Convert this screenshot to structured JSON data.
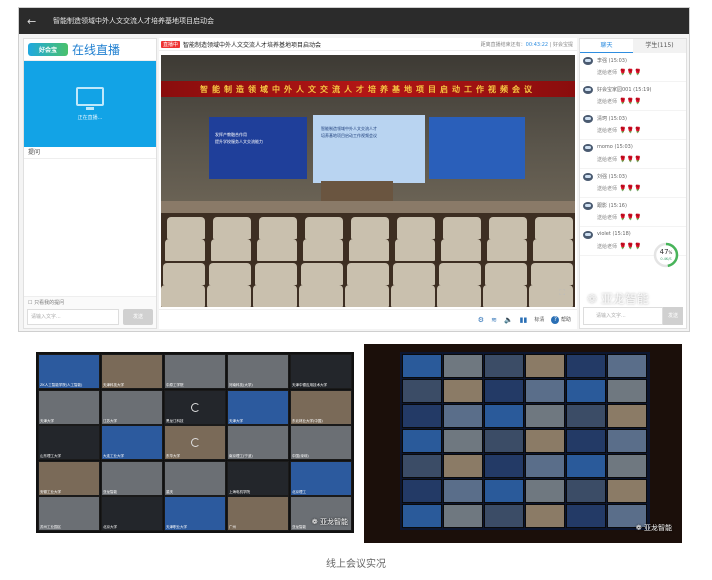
{
  "app": {
    "window_title": "智能制造领域中外人文交流人才培养基地项目启动会",
    "brand": {
      "logo_text": "好会宝",
      "title": "在线直播"
    },
    "camera": {
      "status": "正在直播..."
    },
    "qa": {
      "header": "提问",
      "anonymous_label": "只看我的提问",
      "input_placeholder": "请输入文字...",
      "send_label": "发送"
    },
    "video": {
      "live_badge": "直播中",
      "title": "智能制造领域中外人文交流人才培养基地项目启动会",
      "meta_prefix": "距离直播结束还有：",
      "countdown": "00:43:22",
      "meta_suffix": "| 好会宝提",
      "banner": "智能制造领域中外人文交流人才培养基地项目启动工作视频会议",
      "left_screen_lines": [
        "发挥产教融合作用",
        "提升学校服务人文交流能力"
      ],
      "mid_screen_lines": [
        "智能制造领域中外人文交流人才",
        "培养基地项目启动工作视频会议"
      ]
    },
    "controls": {
      "quality_label": "标清",
      "help_label": "帮助"
    },
    "chat": {
      "tabs": [
        "聊天",
        "学生(115)"
      ],
      "messages": [
        {
          "name": "李强",
          "time": "(15:03)",
          "text": "送给老师"
        },
        {
          "name": "好会宝家园001",
          "time": "(15:19)",
          "text": "送给老师"
        },
        {
          "name": "清珂",
          "time": "(15:03)",
          "text": "送给老师"
        },
        {
          "name": "momo",
          "time": "(15:03)",
          "text": "送给老师"
        },
        {
          "name": "刘强",
          "time": "(15:03)",
          "text": "送给老师"
        },
        {
          "name": "跟影",
          "time": "(15:16)",
          "text": "送给老师"
        },
        {
          "name": "violet",
          "time": "(15:18)",
          "text": "送给老师"
        }
      ],
      "flowers": "🌹🌹🌹",
      "gauge_value": "47",
      "gauge_unit": "%",
      "gauge_sub": "0.4K/S",
      "gauge_fraction": 0.47,
      "input_placeholder": "请输入文字...",
      "send_label": "发送"
    },
    "watermark": "亚龙智能"
  },
  "grid_photo": {
    "tiles": [
      "ZK人工智能学院(人工智能)",
      "天津科技大学",
      "中原工学院",
      "河南科技(大学)",
      "天津中德应用技术大学",
      "天津大学",
      "江苏大学",
      "黑龙江科技",
      "天津大学",
      "东北林业大学(中国)",
      "山东理工大学",
      "大连工业大学",
      "东华大学",
      "南京理工(宁波)",
      "中国(深圳)",
      "安徽工业大学",
      "亚龙智能",
      "重庆",
      "上海电机学院",
      "北京理工",
      "苏州工业园区",
      "北京大学",
      "天津职业大学",
      "广州",
      "亚龙智能"
    ],
    "watermark": "亚龙智能"
  },
  "room_photo": {
    "watermark": "亚龙智能"
  },
  "caption": "线上会议实况",
  "colors": {
    "accent": "#2e8de0",
    "live_blue": "#12a3e6",
    "banner_red": "#b31616"
  }
}
